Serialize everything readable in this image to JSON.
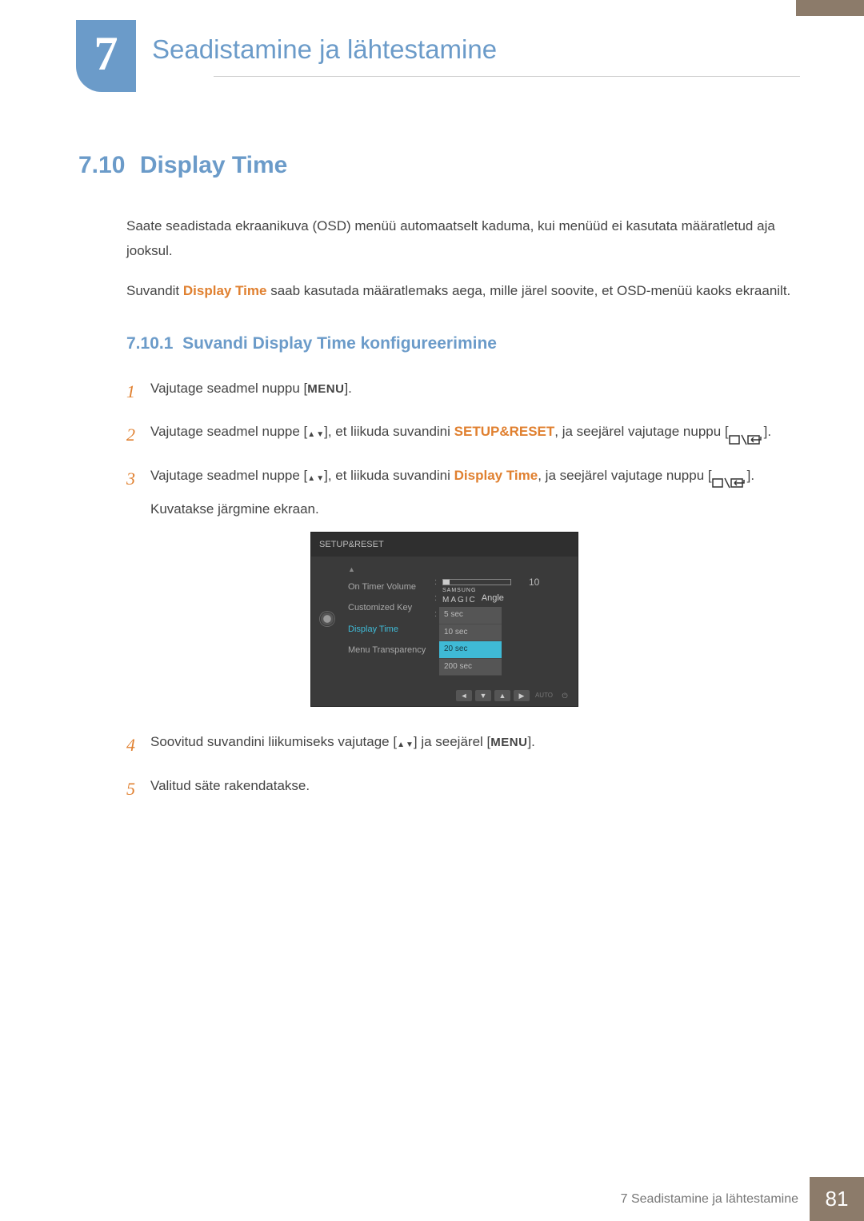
{
  "chapter": {
    "number": "7",
    "title": "Seadistamine ja lähtestamine"
  },
  "section": {
    "number": "7.10",
    "title": "Display Time"
  },
  "intro": {
    "p1": "Saate seadistada ekraanikuva (OSD) menüü automaatselt kaduma, kui menüüd ei kasutata määratletud aja jooksul.",
    "p2a": "Suvandit ",
    "p2_hl": "Display Time",
    "p2b": " saab kasutada määratlemaks aega, mille järel soovite, et OSD-menüü kaoks ekraanilt."
  },
  "subsection": {
    "number": "7.10.1",
    "title": "Suvandi Display Time konfigureerimine"
  },
  "steps": {
    "s1": {
      "num": "1",
      "a": "Vajutage seadmel nuppu [",
      "menu": "MENU",
      "b": "]."
    },
    "s2": {
      "num": "2",
      "a": "Vajutage seadmel nuppe [",
      "b": "], et liikuda suvandini ",
      "hl": "SETUP&RESET",
      "c": ", ja seejärel vajutage nuppu [",
      "d": "]."
    },
    "s3": {
      "num": "3",
      "a": "Vajutage seadmel nuppe [",
      "b": "], et liikuda suvandini ",
      "hl": "Display Time",
      "c": ", ja seejärel vajutage nuppu [",
      "d": "].",
      "e": "Kuvatakse järgmine ekraan."
    },
    "s4": {
      "num": "4",
      "a": "Soovitud suvandini liikumiseks vajutage [",
      "b": "] ja seejärel [",
      "menu": "MENU",
      "c": "]."
    },
    "s5": {
      "num": "5",
      "a": "Valitud säte rakendatakse."
    }
  },
  "osd": {
    "title": "SETUP&RESET",
    "menu": {
      "item1": "On Timer Volume",
      "item2": "Customized Key",
      "item3": "Display Time",
      "item4": "Menu Transparency"
    },
    "slider_value": "10",
    "magic_top": "SAMSUNG",
    "magic_bottom": "MAGIC",
    "magic_suffix": "Angle",
    "options": {
      "o1": "5 sec",
      "o2": "10 sec",
      "o3": "20 sec",
      "o4": "200 sec"
    },
    "nav_auto": "AUTO"
  },
  "footer": {
    "text": "7 Seadistamine ja lähtestamine",
    "page": "81"
  }
}
